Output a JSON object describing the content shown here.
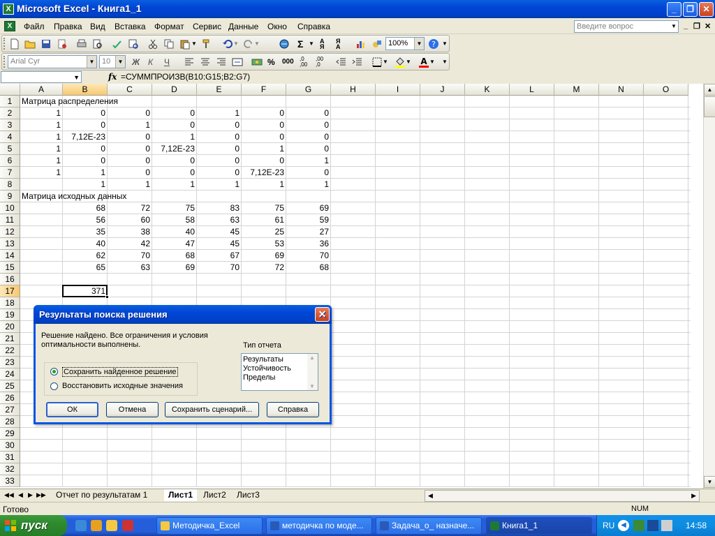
{
  "window": {
    "title": "Microsoft Excel - Книга1_1"
  },
  "menu": {
    "items": [
      "Файл",
      "Правка",
      "Вид",
      "Вставка",
      "Формат",
      "Сервис",
      "Данные",
      "Окно",
      "Справка"
    ],
    "help_placeholder": "Введите вопрос"
  },
  "toolbar": {
    "zoom": "100%",
    "font_name": "Arial Cyr",
    "font_size": "10",
    "bold": "Ж",
    "italic": "К",
    "underline": "Ч"
  },
  "formula_bar": {
    "name_box": "",
    "fx": "fx",
    "formula": "=СУММПРОИЗВ(B10:G15;B2:G7)"
  },
  "columns": [
    "A",
    "B",
    "C",
    "D",
    "E",
    "F",
    "G",
    "H",
    "I",
    "J",
    "K",
    "L",
    "M",
    "N",
    "O"
  ],
  "selected_cell": "B17",
  "cells": {
    "r1": {
      "A": "Матрица распределения"
    },
    "r2": {
      "A": "1",
      "B": "0",
      "C": "0",
      "D": "0",
      "E": "1",
      "F": "0",
      "G": "0"
    },
    "r3": {
      "A": "1",
      "B": "0",
      "C": "1",
      "D": "0",
      "E": "0",
      "F": "0",
      "G": "0"
    },
    "r4": {
      "A": "1",
      "B": "7,12E-23",
      "C": "0",
      "D": "1",
      "E": "0",
      "F": "0",
      "G": "0"
    },
    "r5": {
      "A": "1",
      "B": "0",
      "C": "0",
      "D": "7,12E-23",
      "E": "0",
      "F": "1",
      "G": "0"
    },
    "r6": {
      "A": "1",
      "B": "0",
      "C": "0",
      "D": "0",
      "E": "0",
      "F": "0",
      "G": "1"
    },
    "r7": {
      "A": "1",
      "B": "1",
      "C": "0",
      "D": "0",
      "E": "0",
      "F": "7,12E-23",
      "G": "0"
    },
    "r8": {
      "B": "1",
      "C": "1",
      "D": "1",
      "E": "1",
      "F": "1",
      "G": "1"
    },
    "r9": {
      "A": "Матрица исходных данных"
    },
    "r10": {
      "B": "68",
      "C": "72",
      "D": "75",
      "E": "83",
      "F": "75",
      "G": "69"
    },
    "r11": {
      "B": "56",
      "C": "60",
      "D": "58",
      "E": "63",
      "F": "61",
      "G": "59"
    },
    "r12": {
      "B": "35",
      "C": "38",
      "D": "40",
      "E": "45",
      "F": "25",
      "G": "27"
    },
    "r13": {
      "B": "40",
      "C": "42",
      "D": "47",
      "E": "45",
      "F": "53",
      "G": "36"
    },
    "r14": {
      "B": "62",
      "C": "70",
      "D": "68",
      "E": "67",
      "F": "69",
      "G": "70"
    },
    "r15": {
      "B": "65",
      "C": "63",
      "D": "69",
      "E": "70",
      "F": "72",
      "G": "68"
    },
    "r17": {
      "B": "371"
    }
  },
  "sheet_tabs": [
    "Отчет по результатам 1",
    "Лист1",
    "Лист2",
    "Лист3"
  ],
  "active_tab": "Лист1",
  "status": {
    "text": "Готово",
    "num": "NUM"
  },
  "dialog": {
    "title": "Результаты поиска решения",
    "message_line1": "Решение найдено. Все ограничения и условия",
    "message_line2": "оптимальности выполнены.",
    "report_type_label": "Тип отчета",
    "report_types": [
      "Результаты",
      "Устойчивость",
      "Пределы"
    ],
    "radio_keep": "Сохранить найденное решение",
    "radio_restore": "Восстановить исходные значения",
    "btn_ok": "ОК",
    "btn_cancel": "Отмена",
    "btn_save_scenario": "Сохранить сценарий...",
    "btn_help": "Справка"
  },
  "taskbar": {
    "start": "пуск",
    "tasks": [
      "Методичка_Excel",
      "методичка по моде...",
      "Задача_о_ назначе...",
      "Книга1_1"
    ],
    "lang": "RU",
    "clock": "14:58"
  },
  "colors": {
    "title_blue": "#0046d5",
    "start_green": "#2f8a2f",
    "taskbar_blue": "#245edb",
    "excel_green": "#1d7a34"
  }
}
